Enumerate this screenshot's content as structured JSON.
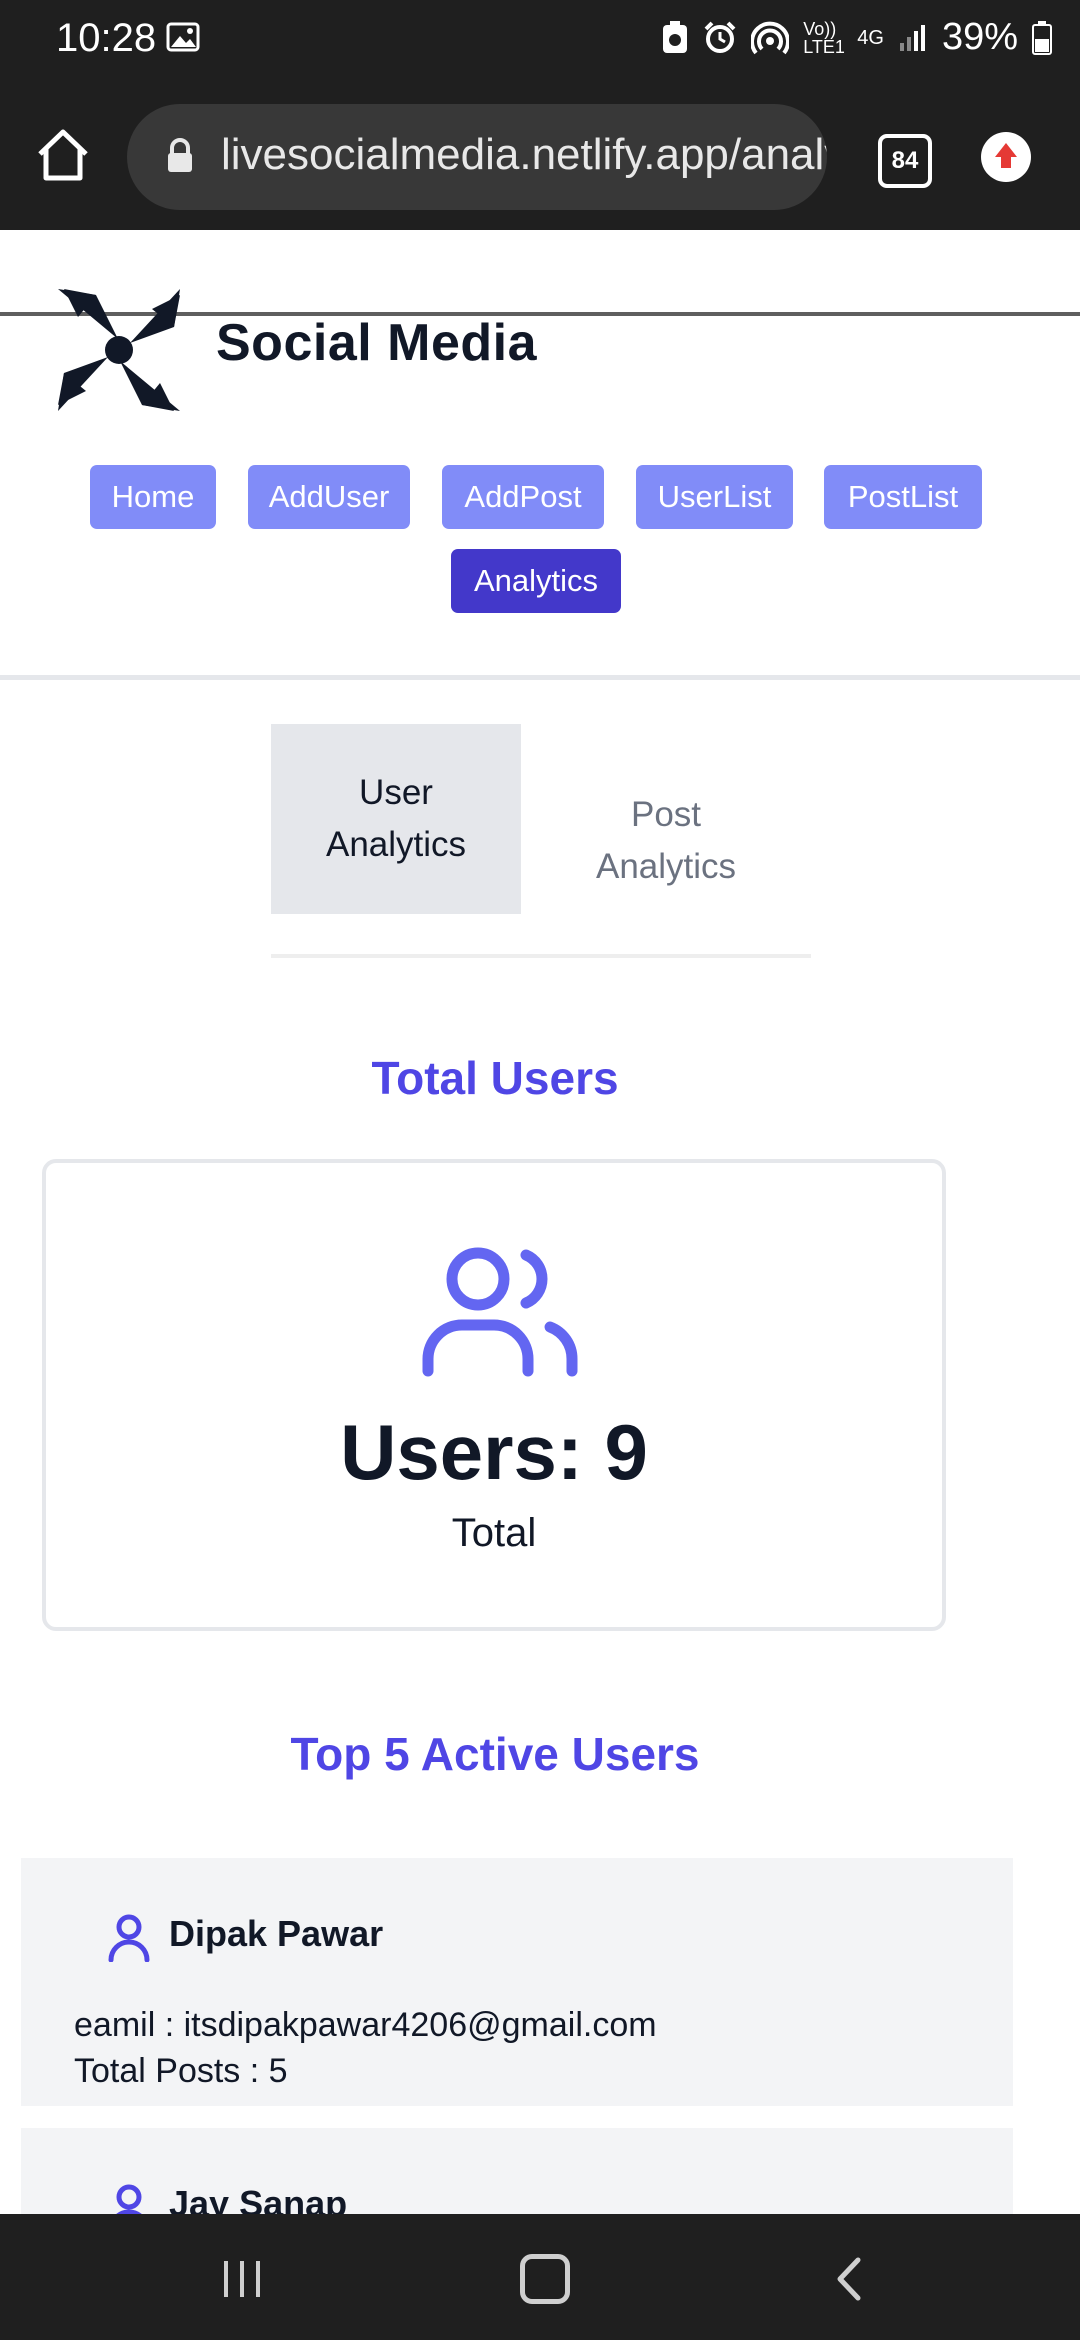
{
  "status_bar": {
    "time": "10:28",
    "image_icon": "gallery-icon",
    "indicators": [
      "sync-icon",
      "alarm-icon",
      "hotspot-icon"
    ],
    "volte": "Vo)) LTE1",
    "network": "4G",
    "battery": "39%"
  },
  "browser": {
    "url": "livesocialmedia.netlify.app/analytics",
    "tabs_count": "84"
  },
  "header": {
    "title": "Social Media"
  },
  "nav": {
    "home": "Home",
    "add_user": "AddUser",
    "add_post": "AddPost",
    "user_list": "UserList",
    "post_list": "PostList",
    "analytics": "Analytics"
  },
  "tabs": {
    "user_line1": "User",
    "user_line2": "Analytics",
    "post_line1": "Post",
    "post_line2": "Analytics"
  },
  "total_users": {
    "heading": "Total Users",
    "count_label": "Users: 9",
    "sub_label": "Total"
  },
  "top_users": {
    "heading": "Top 5 Active Users",
    "items": [
      {
        "name": "Dipak Pawar",
        "email_line": "eamil : itsdipakpawar4206@gmail.com",
        "posts_line": "Total Posts : 5"
      },
      {
        "name": "Jay Sanap"
      }
    ]
  },
  "colors": {
    "accent": "#4f46e5",
    "nav_button": "#818cf8",
    "nav_active": "#4338ca"
  }
}
